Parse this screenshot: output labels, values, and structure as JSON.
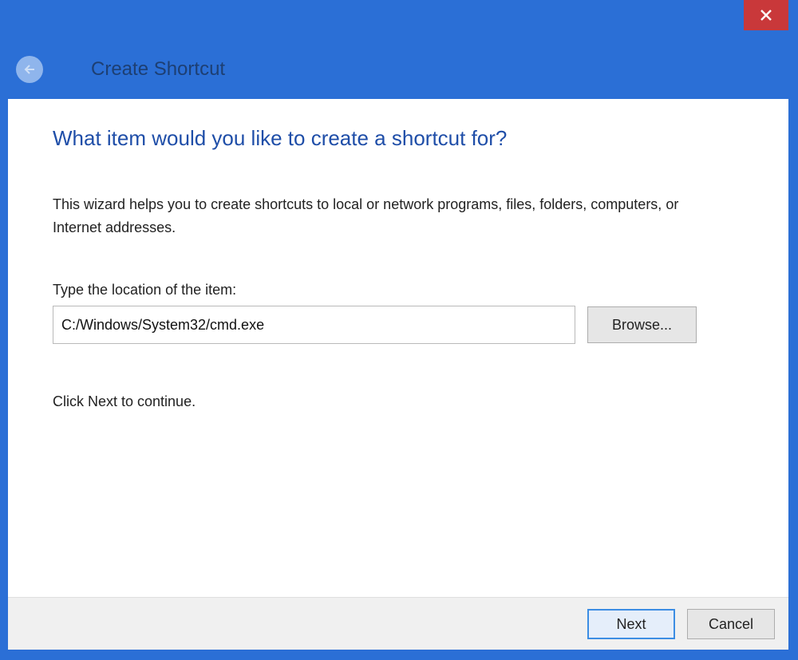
{
  "window": {
    "title": "Create Shortcut",
    "colors": {
      "frame": "#2b6fd6",
      "close": "#c9383a",
      "heading": "#1f4ea8"
    }
  },
  "titlebar": {
    "close_icon": "close-icon",
    "back_icon": "back-arrow-icon"
  },
  "main": {
    "heading": "What item would you like to create a shortcut for?",
    "description": "This wizard helps you to create shortcuts to local or network programs, files, folders, computers, or Internet addresses.",
    "location_label": "Type the location of the item:",
    "location_value": "C:/Windows/System32/cmd.exe",
    "browse_label": "Browse...",
    "hint": "Click Next to continue."
  },
  "footer": {
    "next_label": "Next",
    "cancel_label": "Cancel"
  }
}
